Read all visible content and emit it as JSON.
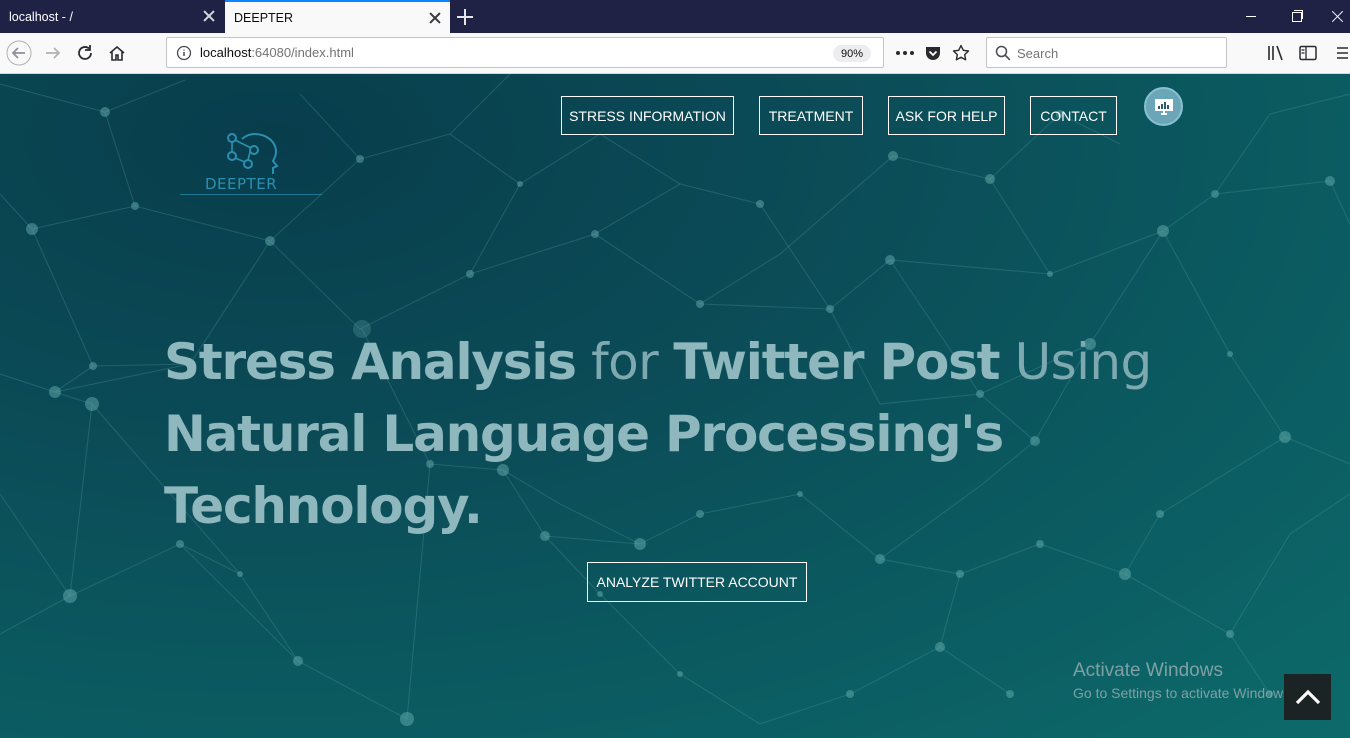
{
  "browser": {
    "tabs": [
      {
        "title": "localhost - /",
        "active": false
      },
      {
        "title": "DEEPTER",
        "active": true
      }
    ],
    "url": {
      "host": "localhost",
      "port_path": ":64080/index.html"
    },
    "zoom": "90%",
    "search": {
      "placeholder": "Search"
    }
  },
  "site": {
    "logo_text": "DEEPTER",
    "nav": [
      {
        "label": "STRESS INFORMATION"
      },
      {
        "label": "TREATMENT"
      },
      {
        "label": "ASK FOR HELP"
      },
      {
        "label": "CONTACT"
      }
    ],
    "hero": {
      "w1": "Stress Analysis",
      "w2": " for ",
      "w3": "Twitter Post",
      "w4": " Using",
      "line2": "Natural Language Processing's",
      "line3": "Technology."
    },
    "cta_label": "ANALYZE TWITTER ACCOUNT"
  },
  "os_watermark": {
    "title": "Activate Windows",
    "subtitle": "Go to Settings to activate Windows."
  },
  "colors": {
    "tabstrip": "#1f2145",
    "tab_accent": "#0a84ff",
    "page_bg": "#0b4d58",
    "hero_text": "#8fb7be"
  }
}
